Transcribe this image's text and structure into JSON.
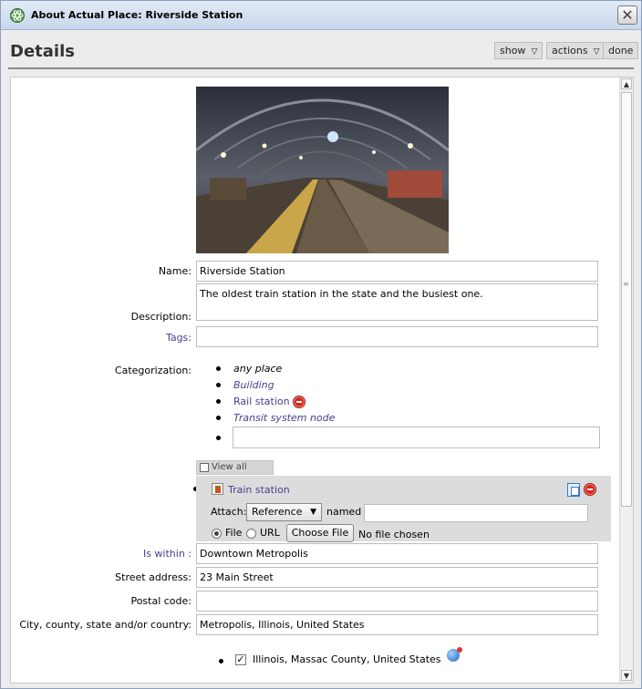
{
  "window": {
    "title": "About Actual Place: Riverside Station",
    "icons": {
      "app": "atom-icon",
      "close": "close-icon"
    }
  },
  "header": {
    "title": "Details",
    "show_label": "show",
    "actions_label": "actions",
    "done_label": "done"
  },
  "form": {
    "name_label": "Name:",
    "name_value": "Riverside Station",
    "description_label": "Description:",
    "description_value": "The oldest train station in the state and the busiest one.",
    "tags_label": "Tags:",
    "tags_value": "",
    "categorization_label": "Categorization:",
    "categories": [
      {
        "label": "any place"
      },
      {
        "label": "Building"
      },
      {
        "label": "Rail station"
      },
      {
        "label": "Transit system node"
      }
    ],
    "view_all_types": "View all types",
    "type_panel": {
      "name": "Train station",
      "attach_label": "Attach:",
      "attach_value": "Reference",
      "named_label": "named",
      "named_value": "",
      "file_label": "File",
      "url_label": "URL",
      "choose_file": "Choose File",
      "no_file": "No file chosen"
    },
    "is_within_label": "Is within :",
    "is_within_value": "Downtown Metropolis",
    "street_label": "Street address:",
    "street_value": "23 Main Street",
    "postal_label": "Postal code:",
    "postal_value": "",
    "city_label": "City, county, state and/or country:",
    "city_value": "Metropolis, Illinois, United States",
    "location_result": "Illinois, Massac County, United States"
  },
  "colors": {
    "link": "#4b3b8f",
    "panel": "#dcdcdc",
    "title_bar": "#c8d7ec"
  }
}
